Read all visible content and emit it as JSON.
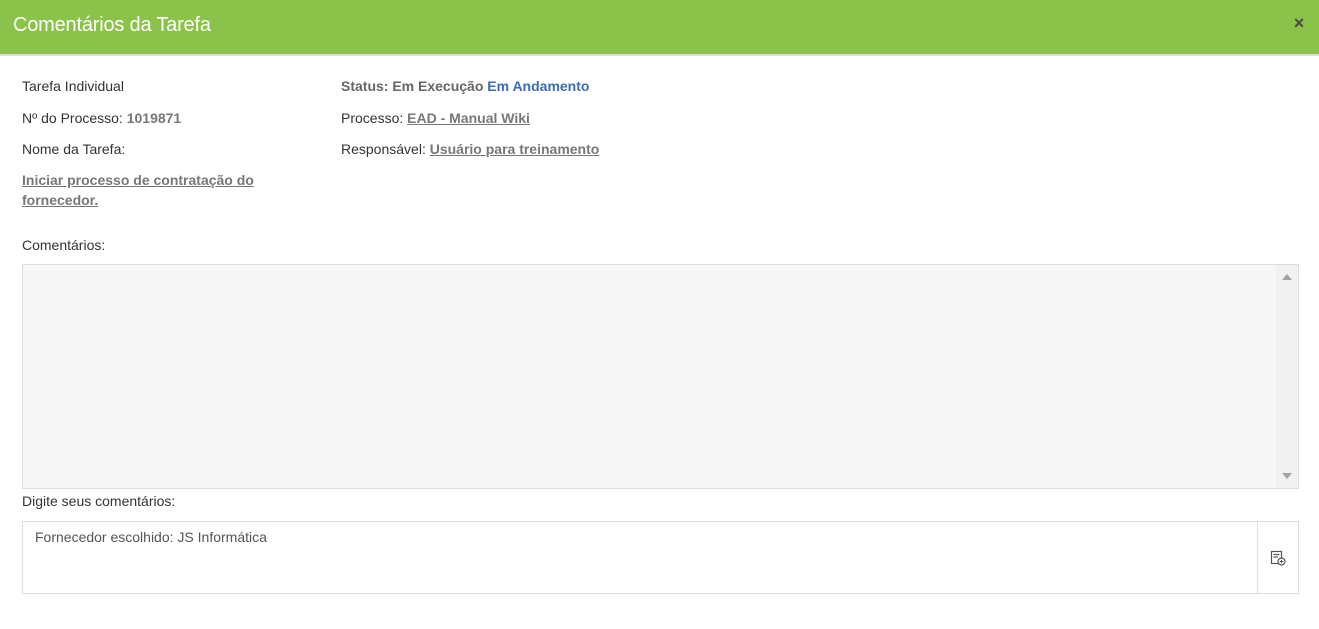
{
  "modal": {
    "title": "Comentários da Tarefa",
    "close_glyph": "×"
  },
  "task": {
    "type": "Tarefa Individual",
    "process_number_label": "Nº do Processo:",
    "process_number": "1019871",
    "name_label": "Nome da Tarefa:",
    "name": "Iniciar processo de contratação do fornecedor.",
    "status_label": "Status: Em Execução",
    "status_value": "Em Andamento",
    "process_label": "Processo:",
    "process": "EAD - Manual Wiki",
    "responsible_label": "Responsável:",
    "responsible": "Usuário para treinamento"
  },
  "comments": {
    "label": "Comentários:",
    "input_label": "Digite seus comentários:",
    "input_value": "Fornecedor escolhido: JS Informática"
  },
  "icons": {
    "close": "close-icon",
    "send": "send-comment-icon",
    "scroll_up": "scroll-up-arrow-icon",
    "scroll_down": "scroll-down-arrow-icon"
  },
  "colors": {
    "header": "#8bc34a",
    "status": "#3c6bb5"
  }
}
